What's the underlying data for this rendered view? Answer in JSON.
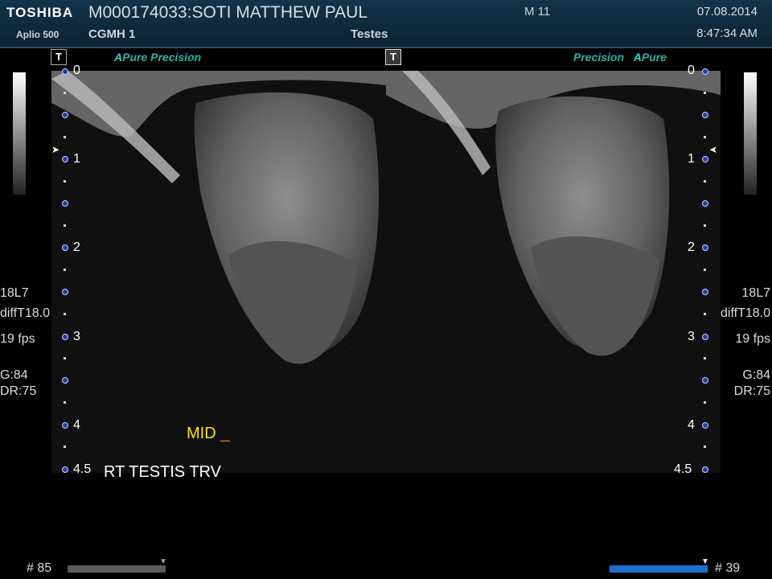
{
  "header": {
    "brand": "TOSHIBA",
    "model": "Aplio 500",
    "patient": "M000174033:SOTI MATTHEW PAUL",
    "site": "CGMH 1",
    "preset": "Testes",
    "mechanical_index": "M 11",
    "date": "07.08.2014",
    "time": "8:47:34 AM"
  },
  "left_panel": {
    "t_badge": "T",
    "mode_apure_a": "A",
    "mode_apure": "Pure",
    "mode_precision": "Precision",
    "depth_labels": [
      "0",
      "1",
      "2",
      "3",
      "4",
      "4.5"
    ],
    "transducer": "18L7",
    "harmonic": "diffT18.0",
    "frame_rate": "19 fps",
    "gain": "G:84",
    "dynamic_range": "DR:75",
    "annotation_mid": "MID",
    "annotation_cursor": "_",
    "annotation_label": "RT TESTIS TRV",
    "cine_frame": "# 85"
  },
  "right_panel": {
    "t_badge": "T",
    "mode_precision": "Precision",
    "mode_apure_a": "A",
    "mode_apure": "Pure",
    "depth_labels": [
      "0",
      "1",
      "2",
      "3",
      "4",
      "4.5"
    ],
    "transducer": "18L7",
    "harmonic": "diffT18.0",
    "frame_rate": "19 fps",
    "gain": "G:84",
    "dynamic_range": "DR:75",
    "cine_frame": "# 39"
  },
  "colors": {
    "header_bg": "#143449",
    "mode_text": "#2ab3a3",
    "annotation_yellow": "#ffe600",
    "cine_active": "#1a6fd0"
  },
  "icons": [
    "t-mode-icon",
    "focus-marker-icon",
    "depth-marker-icon"
  ]
}
